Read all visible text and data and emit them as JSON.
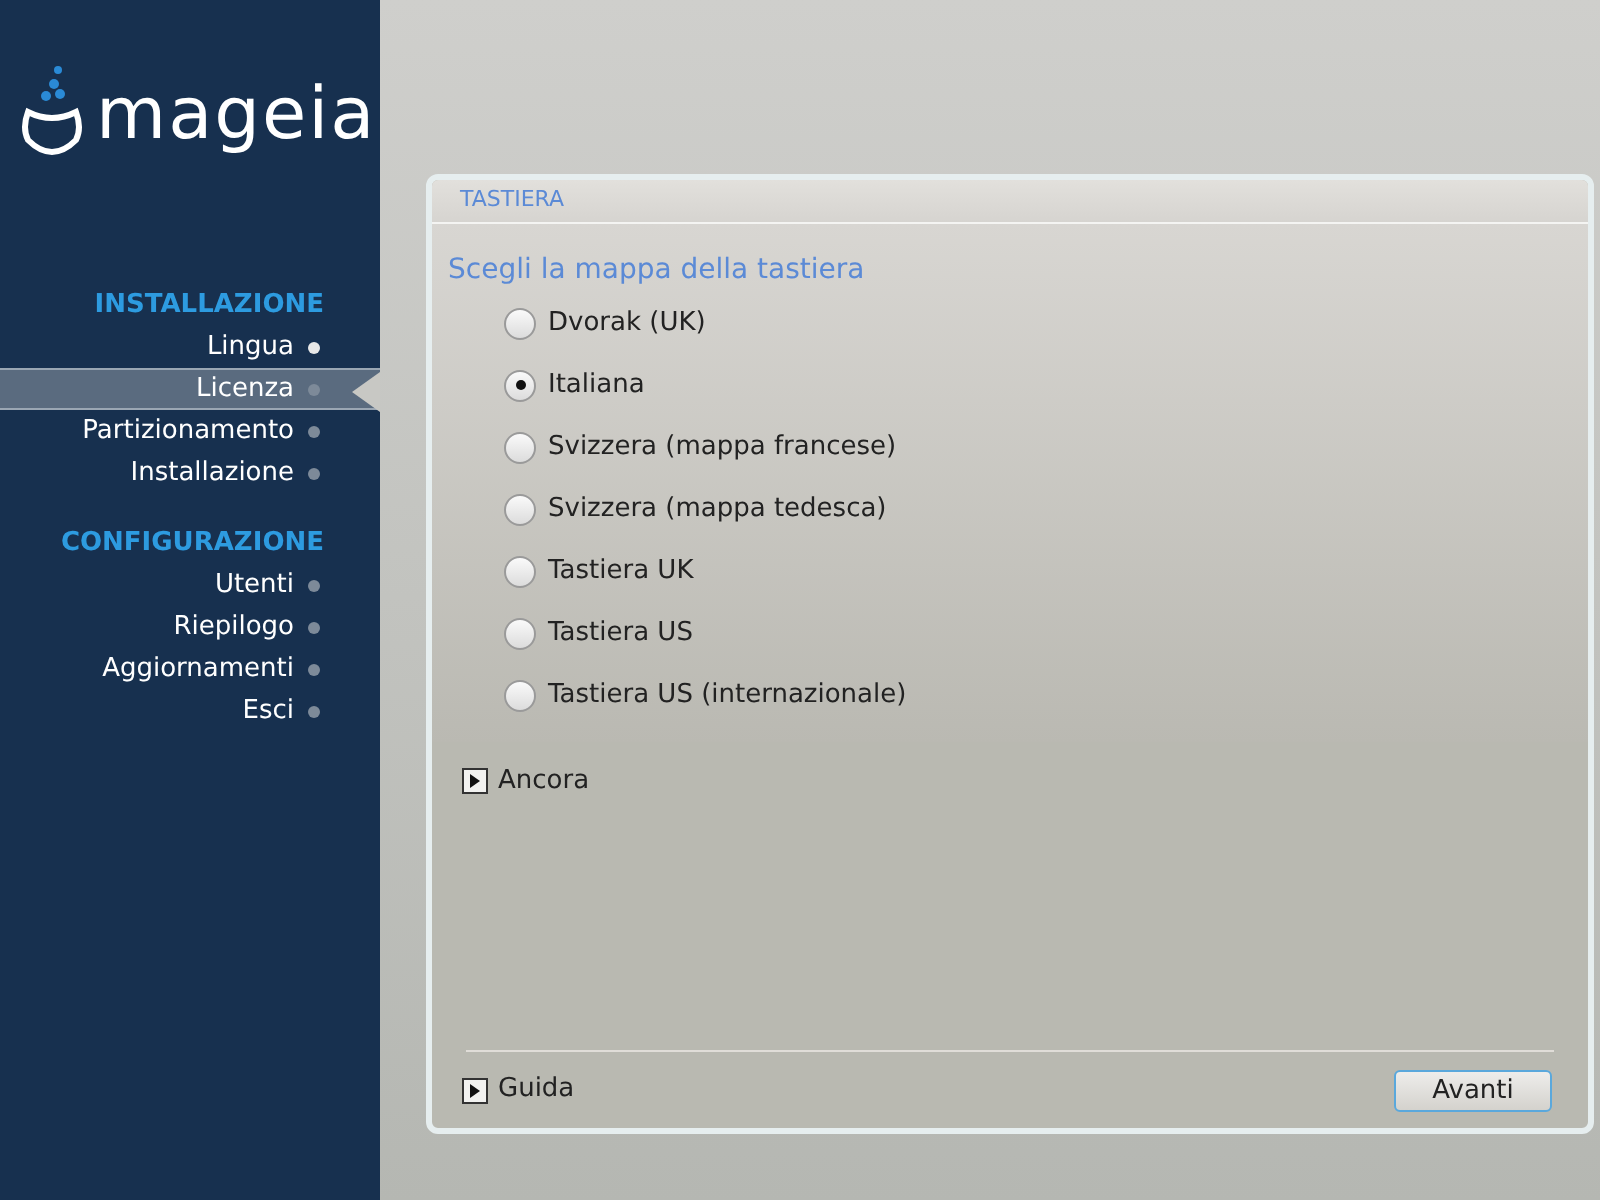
{
  "logo": {
    "text": "mageia"
  },
  "sidebar": {
    "sections": [
      {
        "title": "INSTALLAZIONE",
        "items": [
          {
            "label": "Lingua",
            "selected": false,
            "done": true
          },
          {
            "label": "Licenza",
            "selected": true,
            "done": false
          },
          {
            "label": "Partizionamento",
            "selected": false,
            "done": false
          },
          {
            "label": "Installazione",
            "selected": false,
            "done": false
          }
        ]
      },
      {
        "title": "CONFIGURAZIONE",
        "items": [
          {
            "label": "Utenti",
            "selected": false,
            "done": false
          },
          {
            "label": "Riepilogo",
            "selected": false,
            "done": false
          },
          {
            "label": "Aggiornamenti",
            "selected": false,
            "done": false
          },
          {
            "label": "Esci",
            "selected": false,
            "done": false
          }
        ]
      }
    ]
  },
  "panel": {
    "title": "TASTIERA",
    "prompt": "Scegli la mappa della tastiera",
    "options": [
      {
        "label": "Dvorak (UK)",
        "selected": false
      },
      {
        "label": "Italiana",
        "selected": true
      },
      {
        "label": "Svizzera (mappa francese)",
        "selected": false
      },
      {
        "label": "Svizzera (mappa tedesca)",
        "selected": false
      },
      {
        "label": "Tastiera UK",
        "selected": false
      },
      {
        "label": "Tastiera US",
        "selected": false
      },
      {
        "label": "Tastiera US (internazionale)",
        "selected": false
      }
    ],
    "more": {
      "label": "Ancora",
      "expanded": false
    },
    "help": {
      "label": "Guida",
      "expanded": false
    },
    "next_button": "Avanti"
  }
}
